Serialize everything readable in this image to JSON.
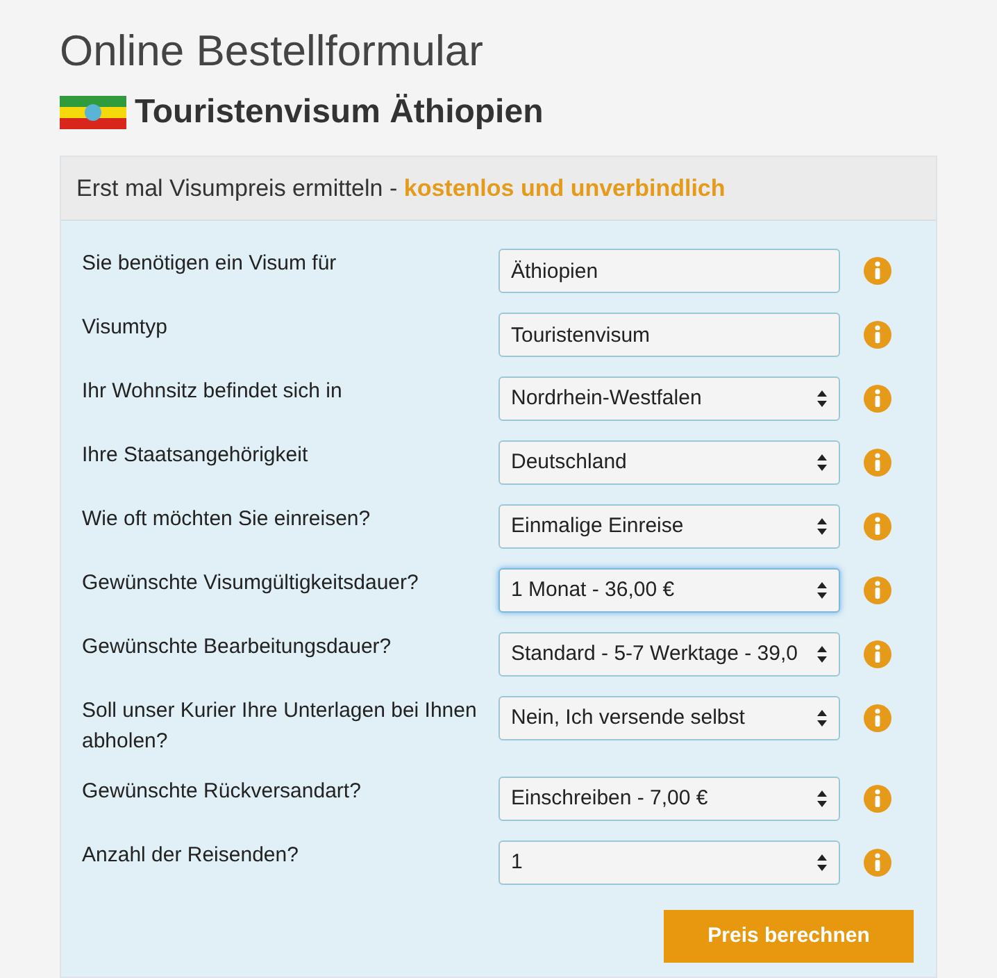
{
  "title": "Online Bestellformular",
  "subtitle": "Touristenvisum Äthiopien",
  "panel": {
    "heading": "Erst mal Visumpreis ermitteln - ",
    "heading_highlight": "kostenlos und unverbindlich",
    "fields": [
      {
        "label": "Sie benötigen ein Visum für",
        "kind": "text",
        "value": "Äthiopien",
        "focused": false
      },
      {
        "label": "Visumtyp",
        "kind": "text",
        "value": "Touristenvisum",
        "focused": false
      },
      {
        "label": "Ihr Wohnsitz befindet sich in",
        "kind": "select",
        "value": "Nordrhein-Westfalen",
        "focused": false
      },
      {
        "label": "Ihre Staatsangehörigkeit",
        "kind": "select",
        "value": "Deutschland",
        "focused": false
      },
      {
        "label": "Wie oft möchten Sie einreisen?",
        "kind": "select",
        "value": "Einmalige Einreise",
        "focused": false
      },
      {
        "label": "Gewünschte Visumgültigkeitsdauer?",
        "kind": "select",
        "value": "1 Monat - 36,00 €",
        "focused": true
      },
      {
        "label": "Gewünschte Bearbeitungsdauer?",
        "kind": "select",
        "value": "Standard - 5-7 Werktage - 39,0",
        "focused": false
      },
      {
        "label": "Soll unser Kurier Ihre Unterlagen bei Ihnen abholen?",
        "kind": "select",
        "value": "Nein, Ich versende selbst",
        "focused": false
      },
      {
        "label": "Gewünschte Rückversandart?",
        "kind": "select",
        "value": "Einschreiben - 7,00 €",
        "focused": false
      },
      {
        "label": "Anzahl der Reisenden?",
        "kind": "select",
        "value": "1",
        "focused": false
      }
    ],
    "submit": "Preis berechnen"
  }
}
